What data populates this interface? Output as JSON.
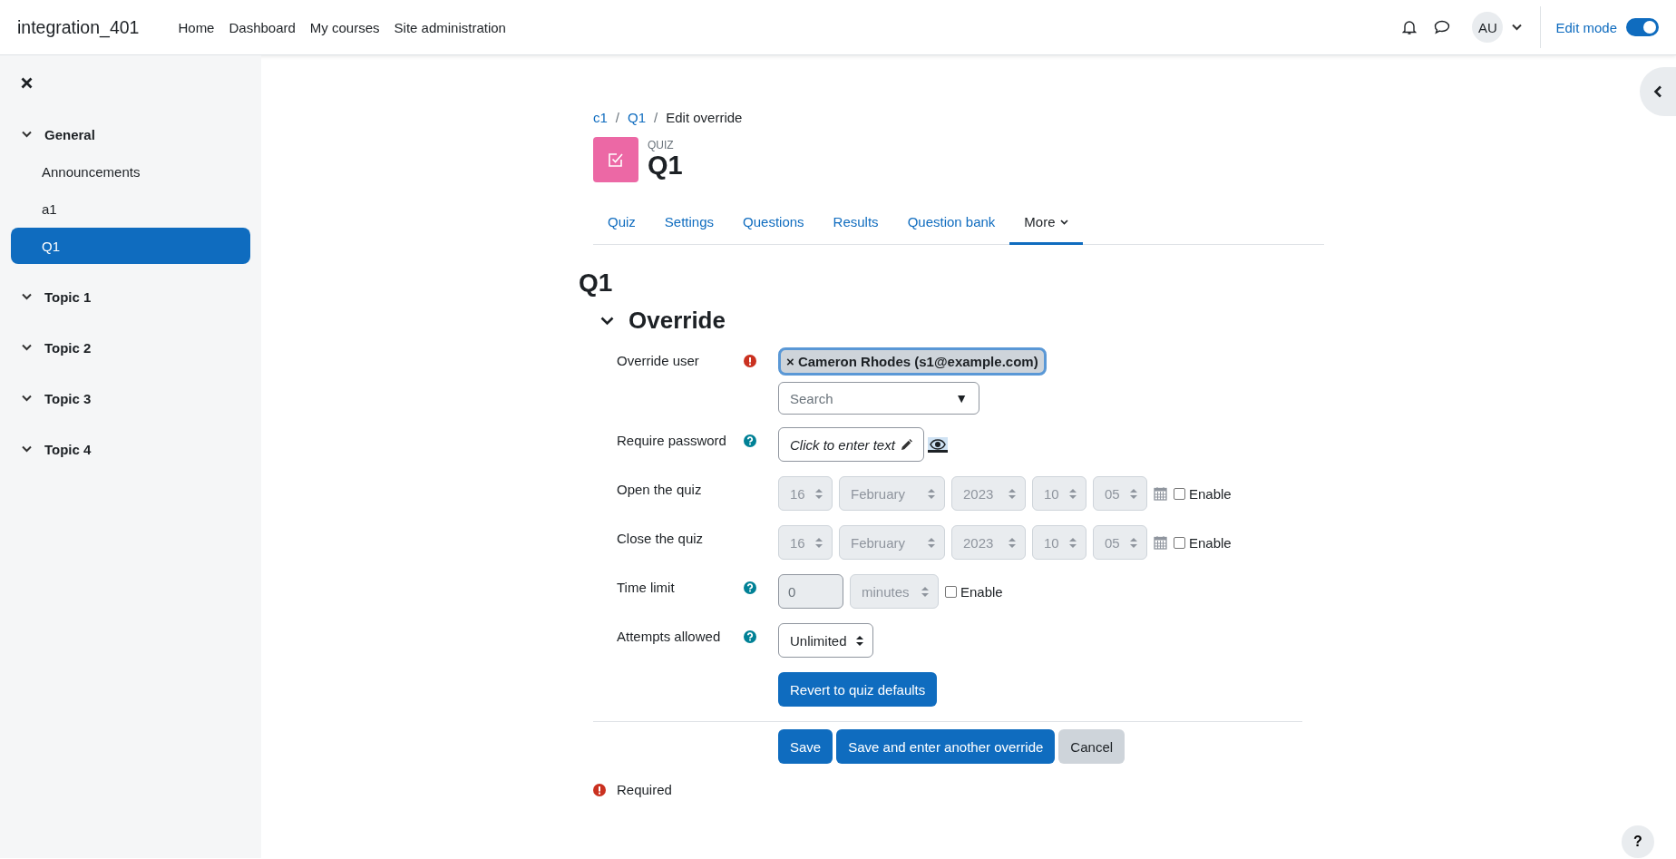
{
  "navbar": {
    "site_name": "integration_401",
    "links": [
      "Home",
      "Dashboard",
      "My courses",
      "Site administration"
    ],
    "avatar": "AU",
    "edit_mode": {
      "label": "Edit mode",
      "on": true
    }
  },
  "drawer": {
    "sections": [
      {
        "label": "General",
        "expanded": true,
        "children": [
          {
            "label": "Announcements",
            "selected": false
          },
          {
            "label": "a1",
            "selected": false
          },
          {
            "label": "Q1",
            "selected": true
          }
        ]
      },
      {
        "label": "Topic 1",
        "expanded": true
      },
      {
        "label": "Topic 2",
        "expanded": true
      },
      {
        "label": "Topic 3",
        "expanded": true
      },
      {
        "label": "Topic 4",
        "expanded": true
      }
    ]
  },
  "breadcrumb": [
    "c1",
    "Q1",
    "Edit override"
  ],
  "breadcrumb_separator": "/",
  "header": {
    "kind_label": "QUIZ",
    "title": "Q1"
  },
  "tabs": [
    {
      "label": "Quiz",
      "selected": false,
      "kind": "link"
    },
    {
      "label": "Settings",
      "selected": false,
      "kind": "link"
    },
    {
      "label": "Questions",
      "selected": false,
      "kind": "link"
    },
    {
      "label": "Results",
      "selected": false,
      "kind": "link"
    },
    {
      "label": "Question bank",
      "selected": false,
      "kind": "link"
    },
    {
      "label": "More",
      "selected": true,
      "kind": "menu"
    }
  ],
  "page_heading": "Q1",
  "section": {
    "title": "Override",
    "expanded": true
  },
  "fields": [
    {
      "kind": "autocomplete",
      "label": "Override user",
      "required": true,
      "help": false,
      "chip": "× Cameron Rhodes (s1@example.com)",
      "placeholder": "Search",
      "arrow": "▼"
    },
    {
      "kind": "password",
      "label": "Require password",
      "required": false,
      "help": true,
      "text": "Click to enter text"
    },
    {
      "kind": "datetime",
      "label": "Open the quiz",
      "required": false,
      "help": false,
      "day": "16",
      "month": "February",
      "year": "2023",
      "hour": "10",
      "minute": "05",
      "enable": {
        "label": "Enable",
        "checked": false
      }
    },
    {
      "kind": "datetime",
      "label": "Close the quiz",
      "required": false,
      "help": false,
      "day": "16",
      "month": "February",
      "year": "2023",
      "hour": "10",
      "minute": "05",
      "enable": {
        "label": "Enable",
        "checked": false
      }
    },
    {
      "kind": "duration",
      "label": "Time limit",
      "required": false,
      "help": true,
      "value": "0",
      "unit": "minutes",
      "enable": {
        "label": "Enable",
        "checked": false
      }
    },
    {
      "kind": "select",
      "label": "Attempts allowed",
      "required": false,
      "help": true,
      "value": "Unlimited"
    },
    {
      "kind": "button",
      "label": "Revert to quiz defaults",
      "required": false,
      "help": false
    }
  ],
  "buttons": [
    {
      "label": "Save",
      "kind": "primary"
    },
    {
      "label": "Save and enter another override",
      "kind": "primary"
    },
    {
      "label": "Cancel",
      "kind": "secondary"
    }
  ],
  "required_note": "Required",
  "help_button": "?"
}
